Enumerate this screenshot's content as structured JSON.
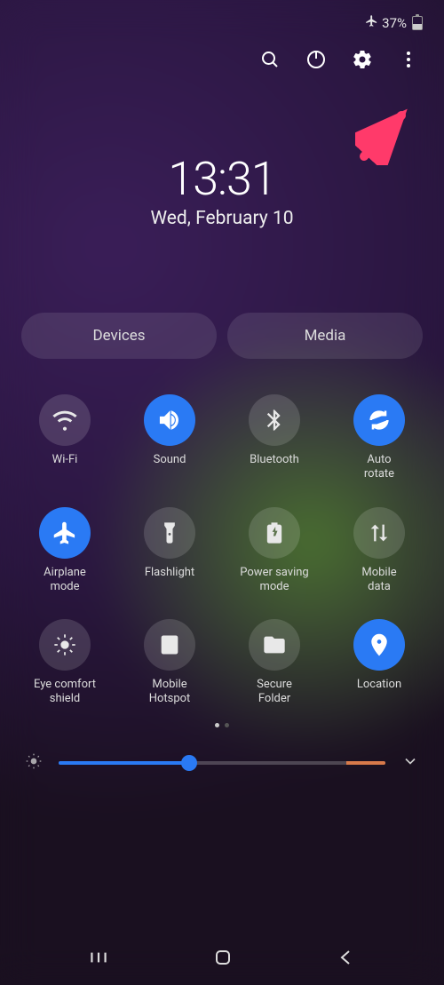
{
  "statusbar": {
    "battery_percent": "37%"
  },
  "clock": {
    "time": "13:31",
    "date": "Wed, February 10"
  },
  "chips": [
    {
      "label": "Devices"
    },
    {
      "label": "Media"
    }
  ],
  "tiles": [
    {
      "id": "wifi",
      "label": "Wi-Fi",
      "on": false,
      "icon": "wifi"
    },
    {
      "id": "sound",
      "label": "Sound",
      "on": true,
      "icon": "sound"
    },
    {
      "id": "bluetooth",
      "label": "Bluetooth",
      "on": false,
      "icon": "bluetooth"
    },
    {
      "id": "autorotate",
      "label": "Auto\nrotate",
      "on": true,
      "icon": "rotate"
    },
    {
      "id": "airplane",
      "label": "Airplane\nmode",
      "on": true,
      "icon": "airplane"
    },
    {
      "id": "flashlight",
      "label": "Flashlight",
      "on": false,
      "icon": "flashlight"
    },
    {
      "id": "powersave",
      "label": "Power saving\nmode",
      "on": false,
      "icon": "battery"
    },
    {
      "id": "mobiledata",
      "label": "Mobile\ndata",
      "on": false,
      "icon": "data"
    },
    {
      "id": "eyecomfort",
      "label": "Eye comfort\nshield",
      "on": false,
      "icon": "eye"
    },
    {
      "id": "hotspot",
      "label": "Mobile\nHotspot",
      "on": false,
      "icon": "hotspot"
    },
    {
      "id": "securefolder",
      "label": "Secure\nFolder",
      "on": false,
      "icon": "folder"
    },
    {
      "id": "location",
      "label": "Location",
      "on": true,
      "icon": "location"
    }
  ],
  "pager": {
    "pages": 2,
    "current": 0
  },
  "brightness_pct": 40
}
